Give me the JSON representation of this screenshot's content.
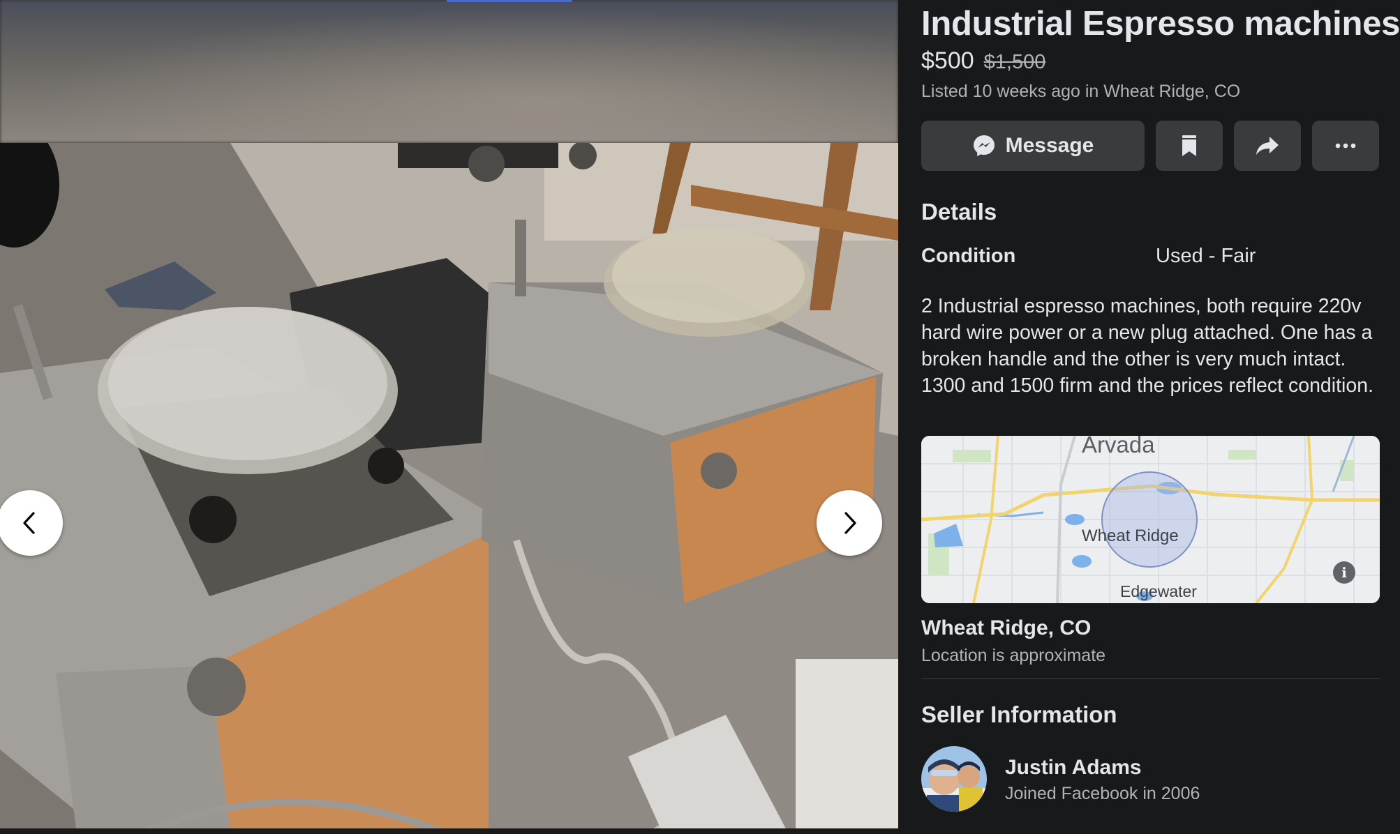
{
  "listing": {
    "title": "Industrial Espresso machines",
    "price": "$500",
    "original_price": "$1,500",
    "listed": "Listed 10 weeks ago in Wheat Ridge, CO"
  },
  "actions": {
    "message_label": "Message",
    "icons": [
      "messenger-icon",
      "save-icon",
      "share-icon",
      "more-icon"
    ]
  },
  "details": {
    "heading": "Details",
    "condition_label": "Condition",
    "condition_value": "Used - Fair",
    "description": "2 Industrial espresso machines, both require 220v hard wire power or a new plug attached. One has a broken handle and the other is very much intact. 1300 and 1500 firm and the prices reflect condition."
  },
  "map": {
    "labels": {
      "north": "Arvada",
      "center": "Wheat Ridge",
      "south": "Edgewater"
    },
    "info_icon": "i"
  },
  "location": {
    "city": "Wheat Ridge, CO",
    "note": "Location is approximate"
  },
  "seller": {
    "heading": "Seller Information",
    "name": "Justin Adams",
    "joined": "Joined Facebook in 2006"
  },
  "viewer": {
    "prev_icon": "chevron-left-icon",
    "next_icon": "chevron-right-icon"
  },
  "colors": {
    "page_bg": "#18191a",
    "button_bg": "#3a3b3c",
    "primary_text": "#e4e6eb",
    "secondary_text": "#b0b3b8"
  }
}
